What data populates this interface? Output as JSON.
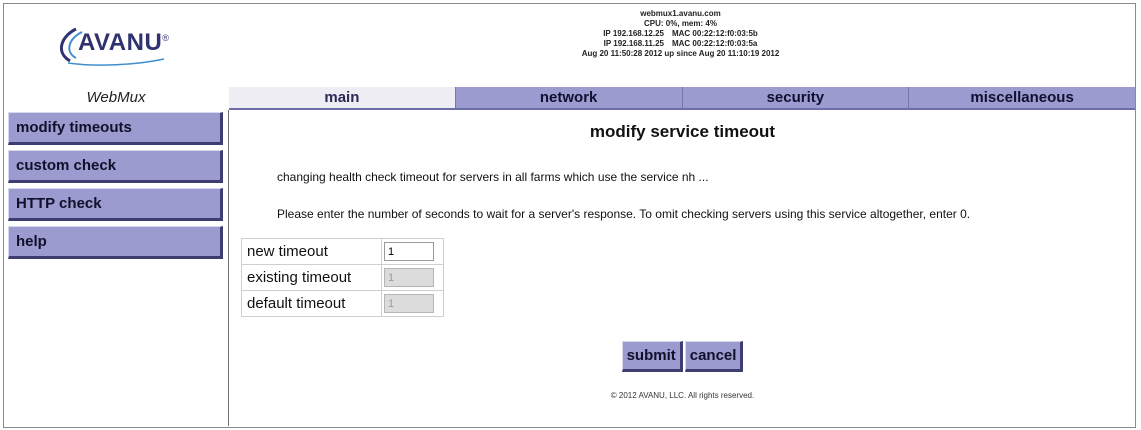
{
  "header": {
    "brand": "AVANU",
    "brand_mark": "®",
    "hostname": "webmux1.avanu.com",
    "cpu_mem": "CPU: 0%, mem: 4%",
    "interfaces": [
      {
        "ip": "IP 192.168.12.25",
        "mac": "MAC 00:22:12:f0:03:5b"
      },
      {
        "ip": "IP 192.168.11.25",
        "mac": "MAC 00:22:12:f0:03:5a"
      }
    ],
    "uptime": "Aug 20 11:50:28 2012 up since Aug 20 11:10:19 2012"
  },
  "product": "WebMux",
  "tabs": [
    {
      "label": "main",
      "active": true
    },
    {
      "label": "network",
      "active": false
    },
    {
      "label": "security",
      "active": false
    },
    {
      "label": "miscellaneous",
      "active": false
    }
  ],
  "sidebar": {
    "items": [
      {
        "label": "modify timeouts"
      },
      {
        "label": "custom check"
      },
      {
        "label": "HTTP check"
      },
      {
        "label": "help"
      }
    ]
  },
  "main": {
    "title": "modify service timeout",
    "description": "changing health check timeout for servers in all farms which use the service nh ...",
    "instructions": "Please enter the number of seconds to wait for a server's response. To omit checking servers using this service altogether, enter 0.",
    "fields": [
      {
        "label": "new timeout",
        "value": "1",
        "enabled": true
      },
      {
        "label": "existing timeout",
        "value": "1",
        "enabled": false
      },
      {
        "label": "default timeout",
        "value": "1",
        "enabled": false
      }
    ],
    "submit_label": "submit",
    "cancel_label": "cancel"
  },
  "footer": "© 2012 AVANU, LLC. All rights reserved.",
  "colors": {
    "tab_bg": "#9b9bd0",
    "tab_active_bg": "#ededf3",
    "button_bg": "#9b9bd0",
    "brand": "#2f3270"
  }
}
